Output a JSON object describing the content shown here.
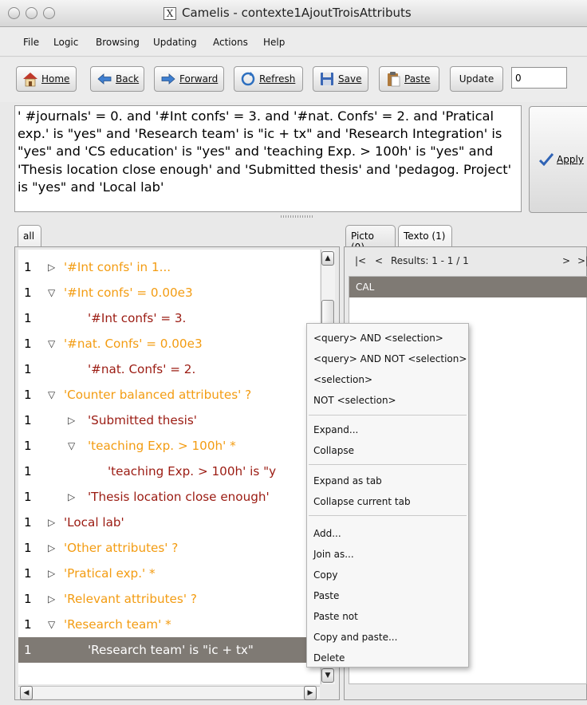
{
  "window": {
    "title": "Camelis - contexte1AjoutTroisAttributs"
  },
  "menubar": {
    "items": [
      "File",
      "Logic",
      "Browsing",
      "Updating",
      "Actions",
      "Help"
    ]
  },
  "toolbar": {
    "home": "Home",
    "back": "Back",
    "forward": "Forward",
    "refresh": "Refresh",
    "save": "Save",
    "paste": "Paste",
    "update": "Update",
    "update_value": "0"
  },
  "query": {
    "text": "' #journals' = 0. and '#Int confs' = 3. and '#nat. Confs' = 2. and 'Pratical exp.' is \"yes\" and 'Research team' is \"ic + tx\" and 'Research Integration' is \"yes\" and 'CS education' is \"yes\" and 'teaching Exp. > 100h' is \"yes\" and 'Thesis location close enough' and 'Submitted thesis' and 'pedagog. Project' is \"yes\" and 'Local lab'",
    "apply_label": "Apply"
  },
  "left_tab": "all",
  "tree": [
    {
      "count": "1",
      "twisty": "right",
      "text": "'#Int confs' in 1...",
      "color": "#f39c12"
    },
    {
      "count": "1",
      "twisty": "down",
      "text": "'#Int confs' = 0.00e3",
      "color": "#f39c12"
    },
    {
      "count": "1",
      "twisty": "",
      "text": "'#Int confs' = 3.",
      "color": "#9b1b12"
    },
    {
      "count": "1",
      "twisty": "down",
      "text": "'#nat. Confs' = 0.00e3",
      "color": "#f39c12"
    },
    {
      "count": "1",
      "twisty": "",
      "text": "'#nat. Confs' = 2.",
      "color": "#9b1b12"
    },
    {
      "count": "1",
      "twisty": "down",
      "text": "'Counter balanced attributes' ?",
      "color": "#f39c12"
    },
    {
      "count": "1",
      "twisty": "right",
      "text": "'Submitted thesis'",
      "color": "#9b1b12"
    },
    {
      "count": "1",
      "twisty": "down",
      "text": "'teaching Exp.  > 100h' *",
      "color": "#f39c12"
    },
    {
      "count": "1",
      "twisty": "",
      "text": "'teaching Exp.  > 100h' is \"y",
      "color": "#9b1b12"
    },
    {
      "count": "1",
      "twisty": "right",
      "text": "'Thesis location close enough'",
      "color": "#9b1b12"
    },
    {
      "count": "1",
      "twisty": "right",
      "text": "'Local lab'",
      "color": "#9b1b12"
    },
    {
      "count": "1",
      "twisty": "right",
      "text": "'Other attributes' ?",
      "color": "#f39c12"
    },
    {
      "count": "1",
      "twisty": "right",
      "text": "'Pratical exp.' *",
      "color": "#f39c12"
    },
    {
      "count": "1",
      "twisty": "right",
      "text": "'Relevant attributes' ?",
      "color": "#f39c12"
    },
    {
      "count": "1",
      "twisty": "down",
      "text": "'Research team' *",
      "color": "#f39c12"
    },
    {
      "count": "1",
      "twisty": "",
      "text": "'Research team' is \"ic + tx\"",
      "color": "#ffffff",
      "selected": true
    }
  ],
  "right_tabs": [
    "Picto (0)",
    "Texto (1)"
  ],
  "results": {
    "first": "|<",
    "prev": "<",
    "label": "Results: 1 - 1 / 1",
    "next": ">",
    "last": ">|",
    "items": [
      "CAL"
    ]
  },
  "context_menu": {
    "group1": [
      "<query> AND <selection>",
      "<query> AND NOT <selection>",
      "<selection>",
      "NOT <selection>"
    ],
    "group2": [
      "Expand...",
      "Collapse"
    ],
    "group3": [
      "Expand as tab",
      "Collapse current tab"
    ],
    "group4": [
      "Add...",
      "Join as...",
      "Copy",
      "Paste",
      "Paste not",
      "Copy and paste...",
      "Delete"
    ]
  }
}
